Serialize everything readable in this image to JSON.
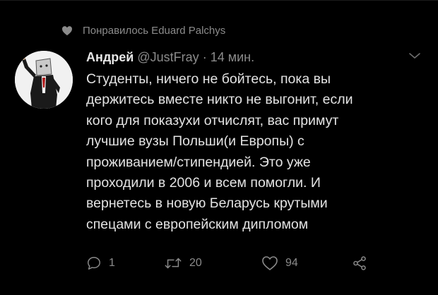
{
  "context": {
    "icon": "heart-icon",
    "text": "Понравилось Eduard Palchys"
  },
  "tweet": {
    "author_name": "Андрей",
    "author_handle": "@JustFray",
    "separator": "·",
    "time": "14 мин.",
    "text": "Студенты, ничего не бойтесь, пока вы\nдержитесь вместе никто не выгонит, если\nкого для показухи отчислят, вас примут\nлучшие вузы Польши(и Европы) с\nпроживанием/стипендией. Это уже\nпроходили в 2006 и всем помогли. И\nвернетесь в новую Беларусь крутыми\nспецами с европейским дипломом",
    "avatar_icon": "avatar-figure-icon",
    "menu_icon": "chevron-down-icon"
  },
  "actions": {
    "reply_count": "1",
    "retweet_count": "20",
    "like_count": "94",
    "share_icon": "share-icon"
  },
  "colors": {
    "background": "#000000",
    "text_primary": "#e3e3e3",
    "text_secondary": "#8b8b8b"
  }
}
